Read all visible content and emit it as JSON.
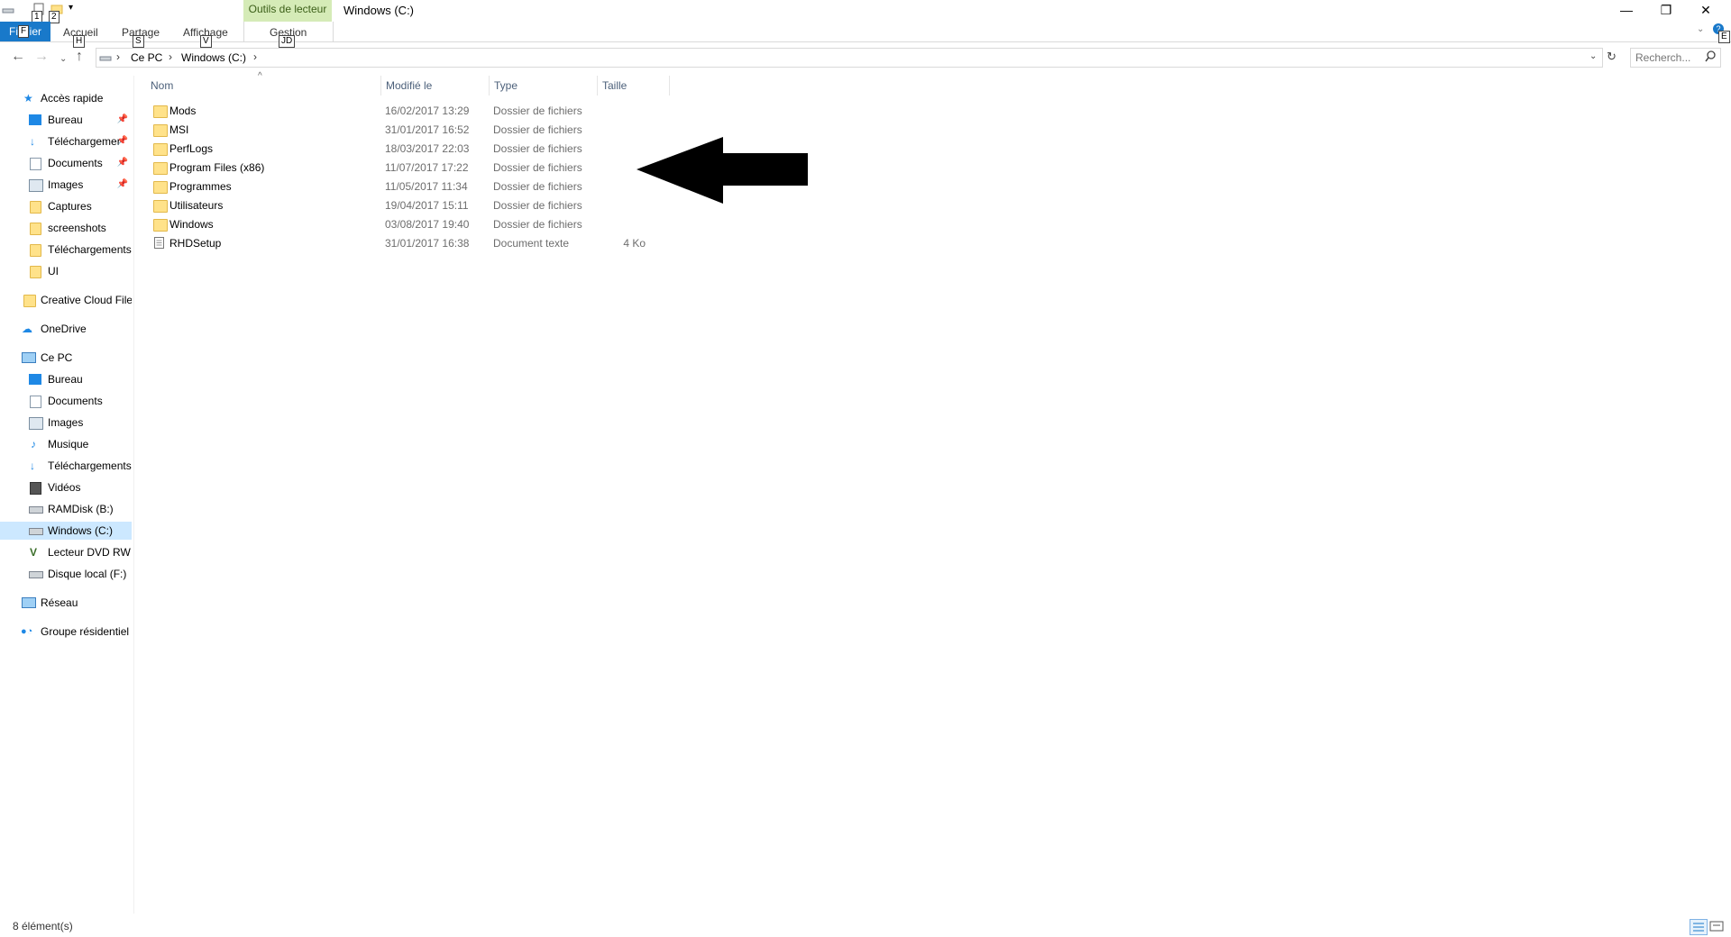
{
  "titlebar": {
    "context_tab": "Outils de lecteur",
    "window_title": "Windows (C:)",
    "keytips": {
      "qa1": "1",
      "qa2": "2",
      "right": "E"
    },
    "buttons": {
      "minimize": "—",
      "restore": "❐",
      "close": "✕"
    }
  },
  "ribbon": {
    "file_label": "Fichier",
    "file_keytip": "F",
    "tabs": [
      {
        "label": "Accueil",
        "keytip": "H"
      },
      {
        "label": "Partage",
        "keytip": "S"
      },
      {
        "label": "Affichage",
        "keytip": "V"
      },
      {
        "label": "Gestion",
        "keytip": "JD"
      }
    ],
    "help_icon": "?",
    "expand_icon": "chevron-down-icon"
  },
  "address": {
    "crumbs": [
      "Ce PC",
      "Windows (C:)"
    ],
    "search_placeholder": "Recherch..."
  },
  "nav": {
    "quick_access": "Accès rapide",
    "quick_items": [
      "Bureau",
      "Téléchargements",
      "Documents",
      "Images",
      "Captures",
      "screenshots",
      "Téléchargements",
      "UI"
    ],
    "creative_cloud": "Creative Cloud Files",
    "onedrive": "OneDrive",
    "this_pc": "Ce PC",
    "pc_items": [
      "Bureau",
      "Documents",
      "Images",
      "Musique",
      "Téléchargements",
      "Vidéos",
      "RAMDisk (B:)",
      "Windows (C:)",
      "Lecteur DVD RW (",
      "Disque local (F:)"
    ],
    "network": "Réseau",
    "homegroup": "Groupe résidentiel"
  },
  "columns": {
    "name": "Nom",
    "modified": "Modifié le",
    "type": "Type",
    "size": "Taille"
  },
  "files": [
    {
      "name": "Mods",
      "modified": "16/02/2017 13:29",
      "type": "Dossier de fichiers",
      "size": "",
      "kind": "folder"
    },
    {
      "name": "MSI",
      "modified": "31/01/2017 16:52",
      "type": "Dossier de fichiers",
      "size": "",
      "kind": "folder"
    },
    {
      "name": "PerfLogs",
      "modified": "18/03/2017 22:03",
      "type": "Dossier de fichiers",
      "size": "",
      "kind": "folder"
    },
    {
      "name": "Program Files (x86)",
      "modified": "11/07/2017 17:22",
      "type": "Dossier de fichiers",
      "size": "",
      "kind": "folder"
    },
    {
      "name": "Programmes",
      "modified": "11/05/2017 11:34",
      "type": "Dossier de fichiers",
      "size": "",
      "kind": "folder"
    },
    {
      "name": "Utilisateurs",
      "modified": "19/04/2017 15:11",
      "type": "Dossier de fichiers",
      "size": "",
      "kind": "folder"
    },
    {
      "name": "Windows",
      "modified": "03/08/2017 19:40",
      "type": "Dossier de fichiers",
      "size": "",
      "kind": "folder"
    },
    {
      "name": "RHDSetup",
      "modified": "31/01/2017 16:38",
      "type": "Document texte",
      "size": "4 Ko",
      "kind": "text"
    }
  ],
  "status": {
    "count": "8 élément(s)"
  },
  "colors": {
    "accent": "#1979ca",
    "context_tab": "#d5ebb7",
    "selected": "#cce8ff",
    "folder": "#ffe28a"
  }
}
